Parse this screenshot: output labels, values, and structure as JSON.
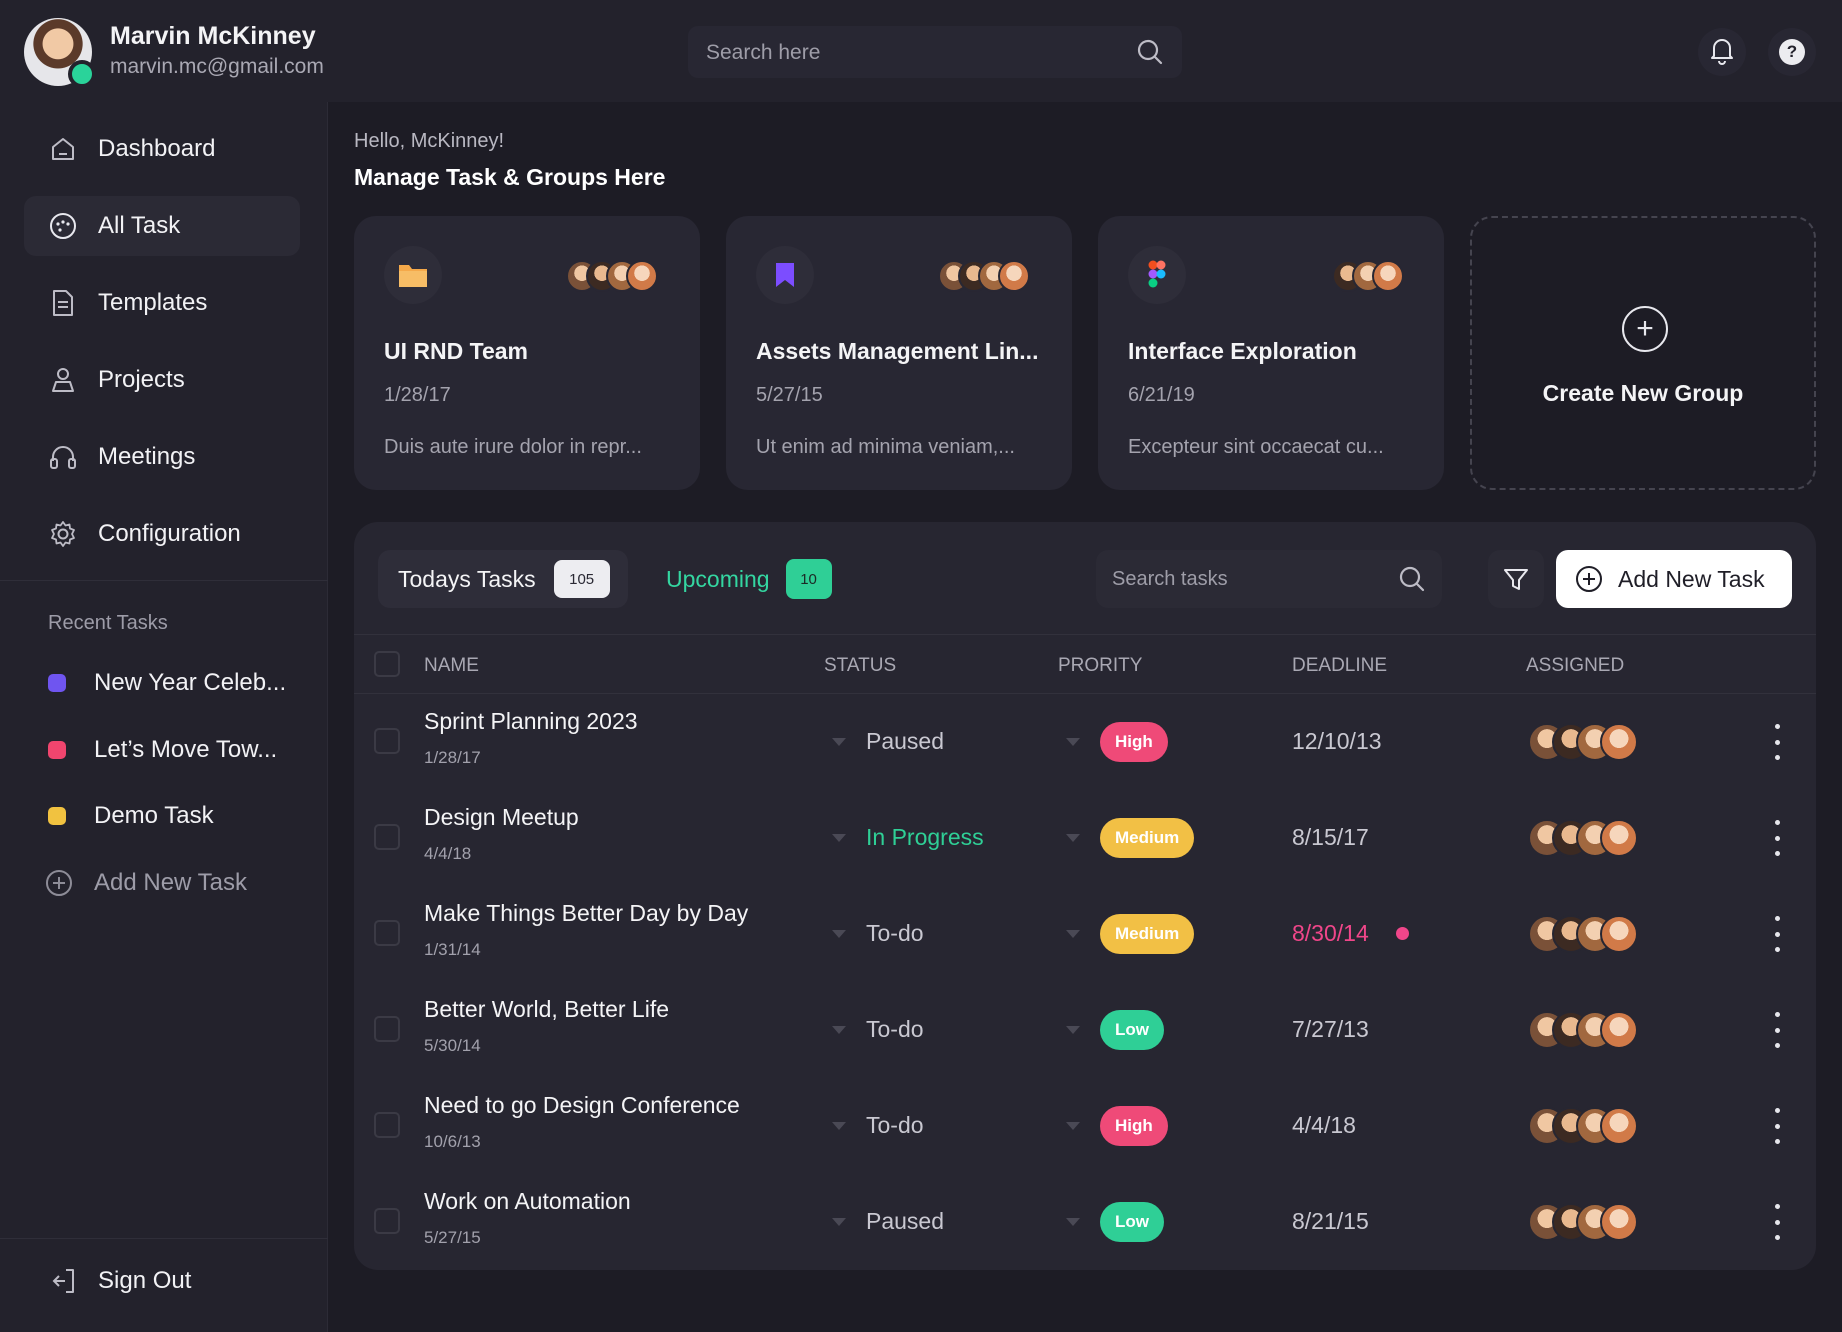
{
  "user": {
    "name": "Marvin McKinney",
    "email": "marvin.mc@gmail.com"
  },
  "top_search": {
    "placeholder": "Search here"
  },
  "sidebar": {
    "items": [
      {
        "label": "Dashboard",
        "icon": "home-icon"
      },
      {
        "label": "All Task",
        "icon": "tasks-icon",
        "active": true
      },
      {
        "label": "Templates",
        "icon": "document-icon"
      },
      {
        "label": "Projects",
        "icon": "projects-icon"
      },
      {
        "label": "Meetings",
        "icon": "headset-icon"
      },
      {
        "label": "Configuration",
        "icon": "gear-icon"
      }
    ],
    "recent_title": "Recent Tasks",
    "recent": [
      {
        "label": "New Year Celeb...",
        "color": "#6f55f0"
      },
      {
        "label": "Let’s Move Tow...",
        "color": "#f0456e"
      },
      {
        "label": "Demo Task",
        "color": "#f1c240"
      }
    ],
    "add_task_label": "Add New Task",
    "signout_label": "Sign Out"
  },
  "greeting": "Hello, McKinney!",
  "headline": "Manage Task & Groups Here",
  "groups": [
    {
      "title": "UI RND Team",
      "date": "1/28/17",
      "desc": "Duis aute irure dolor in repr...",
      "icon": "folder-icon"
    },
    {
      "title": "Assets Management Lin...",
      "date": "5/27/15",
      "desc": "Ut enim ad minima veniam,...",
      "icon": "bookmark-icon"
    },
    {
      "title": "Interface Exploration",
      "date": "6/21/19",
      "desc": "Excepteur sint occaecat cu...",
      "icon": "figma-icon"
    }
  ],
  "create_group": {
    "label": "Create New Group"
  },
  "tasks": {
    "tabs": [
      {
        "label": "Todays Tasks",
        "count": "105"
      },
      {
        "label": "Upcoming",
        "count": "10"
      }
    ],
    "search_placeholder": "Search tasks",
    "add_button": "Add New Task",
    "columns": [
      "NAME",
      "STATUS",
      "PRORITY",
      "DEADLINE",
      "ASSIGNED"
    ],
    "rows": [
      {
        "name": "Sprint Planning 2023",
        "date": "1/28/17",
        "status": "Paused",
        "priority": "High",
        "deadline": "12/10/13"
      },
      {
        "name": "Design Meetup",
        "date": "4/4/18",
        "status": "In Progress",
        "priority": "Medium",
        "deadline": "8/15/17"
      },
      {
        "name": "Make Things Better Day by Day",
        "date": "1/31/14",
        "status": "To-do",
        "priority": "Medium",
        "deadline": "8/30/14",
        "overdue": true
      },
      {
        "name": "Better World, Better Life",
        "date": "5/30/14",
        "status": "To-do",
        "priority": "Low",
        "deadline": "7/27/13"
      },
      {
        "name": "Need to go Design Conference",
        "date": "10/6/13",
        "status": "To-do",
        "priority": "High",
        "deadline": "4/4/18"
      },
      {
        "name": "Work on Automation",
        "date": "5/27/15",
        "status": "Paused",
        "priority": "Low",
        "deadline": "8/21/15"
      }
    ]
  },
  "colors": {
    "accent_green": "#2fcf96",
    "priority_high": "#ef4a78",
    "priority_medium": "#f2c045",
    "priority_low": "#2fcf96",
    "overdue": "#f0468a"
  }
}
